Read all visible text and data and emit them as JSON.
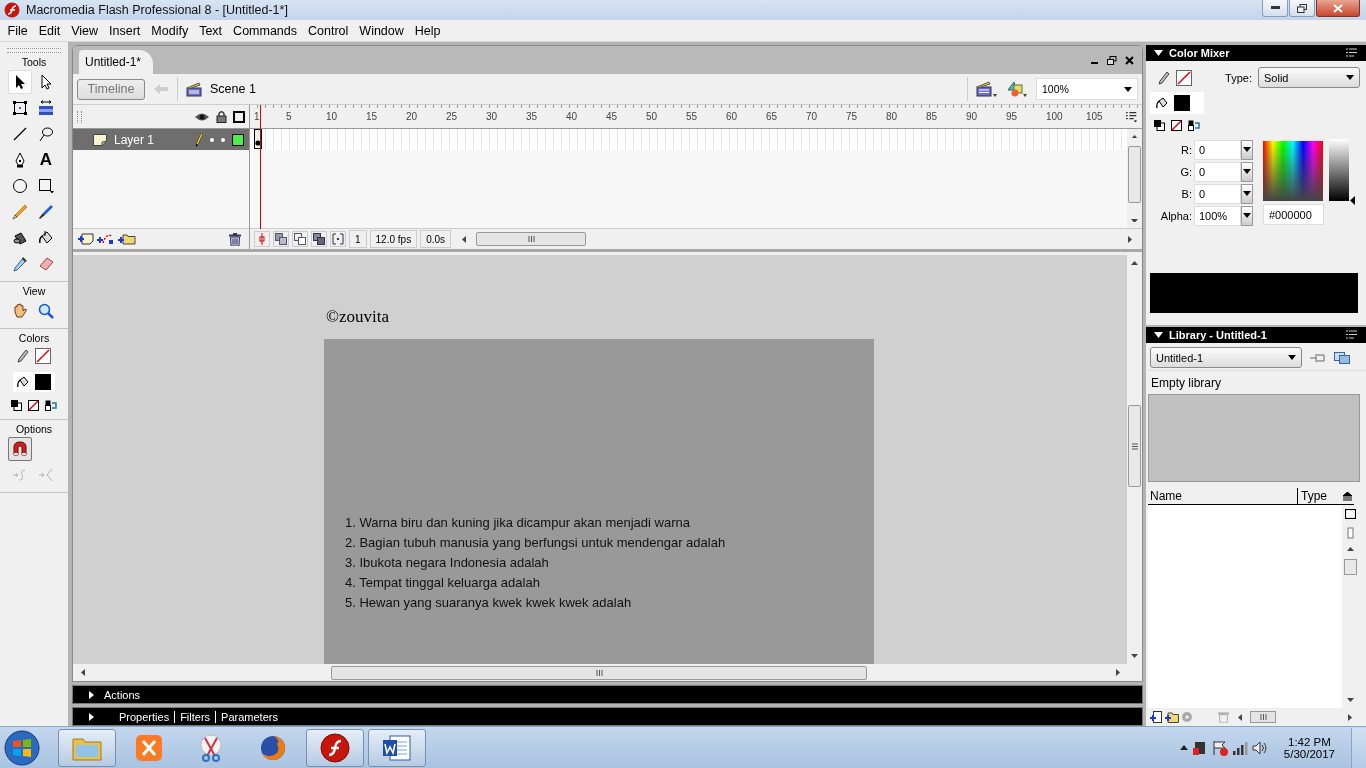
{
  "window": {
    "title": "Macromedia Flash Professional 8 - [Untitled-1*]"
  },
  "menu": [
    "File",
    "Edit",
    "View",
    "Insert",
    "Modify",
    "Text",
    "Commands",
    "Control",
    "Window",
    "Help"
  ],
  "tools_panel": {
    "sections": [
      {
        "label": "Tools",
        "kind": "tools",
        "items": [
          {
            "kind": "pointer",
            "selected": true
          },
          {
            "kind": "hollow-pointer",
            "selected": false
          },
          {
            "kind": "transform-box",
            "selected": false
          },
          {
            "kind": "gradient-transform",
            "selected": false
          },
          {
            "kind": "line",
            "selected": false
          },
          {
            "kind": "lasso",
            "selected": false
          },
          {
            "kind": "pen-nib",
            "selected": false
          },
          {
            "kind": "text",
            "label": "A",
            "selected": false
          },
          {
            "kind": "circle",
            "selected": false
          },
          {
            "kind": "square",
            "selected": false
          },
          {
            "kind": "pencil",
            "selected": false
          },
          {
            "kind": "brush",
            "selected": false
          },
          {
            "kind": "ink-bottle",
            "selected": false
          },
          {
            "kind": "paint-bucket",
            "selected": false
          },
          {
            "kind": "eyedropper",
            "selected": false
          },
          {
            "kind": "eraser",
            "selected": false
          }
        ]
      },
      {
        "label": "View",
        "kind": "tools",
        "items": [
          {
            "kind": "hand",
            "selected": false
          },
          {
            "kind": "magnifier",
            "selected": false
          }
        ]
      },
      {
        "label": "Colors",
        "kind": "colors"
      },
      {
        "label": "Options",
        "kind": "tools",
        "items": [
          {
            "kind": "magnet",
            "selected": true
          },
          {
            "kind": "smooth",
            "selected": false,
            "disabled": true
          },
          {
            "kind": "straighten",
            "selected": false,
            "disabled": true
          }
        ]
      }
    ]
  },
  "document": {
    "tab": "Untitled-1*",
    "timeline_button": "Timeline",
    "scene": "Scene 1",
    "zoom": "100%"
  },
  "timeline": {
    "frame_labels": [
      "1",
      "5",
      "10",
      "15",
      "20",
      "25",
      "30",
      "35",
      "40",
      "45",
      "50",
      "55",
      "60",
      "65",
      "70",
      "75",
      "80",
      "85",
      "90",
      "95",
      "100",
      "105"
    ],
    "layers": [
      {
        "name": "Layer 1",
        "selected": true
      }
    ],
    "current_frame": "1",
    "frame_rate": "12.0 fps",
    "elapsed": "0.0s"
  },
  "stage": {
    "credit": "©zouvita",
    "questions": [
      "1. Warna biru dan kuning jika dicampur akan menjadi warna",
      "2. Bagian tubuh manusia yang berfungsi untuk mendengar adalah",
      "3. Ibukota negara Indonesia adalah",
      "4. Tempat tinggal keluarga adalah",
      "5. Hewan yang suaranya kwek kwek kwek adalah"
    ]
  },
  "panels": {
    "actions": "Actions",
    "properties_tabs": [
      "Properties",
      "Filters",
      "Parameters"
    ]
  },
  "color_mixer": {
    "title": "Color Mixer",
    "type_label": "Type:",
    "type": "Solid",
    "channels": [
      {
        "label": "R:",
        "value": "0"
      },
      {
        "label": "G:",
        "value": "0"
      },
      {
        "label": "B:",
        "value": "0"
      },
      {
        "label": "Alpha:",
        "value": "100%"
      }
    ],
    "brightness": {
      "level": 0
    },
    "hex": "#000000"
  },
  "library": {
    "title": "Library - Untitled-1",
    "document": "Untitled-1",
    "status": "Empty library",
    "columns": [
      "Name",
      "Type"
    ]
  },
  "taskbar": {
    "apps": [
      {
        "kind": "folder",
        "running": true
      },
      {
        "kind": "xampp",
        "running": false
      },
      {
        "kind": "scissors",
        "running": false
      },
      {
        "kind": "firefox",
        "running": false
      },
      {
        "kind": "flash",
        "running": true
      },
      {
        "kind": "word",
        "running": true
      }
    ],
    "time": "1:42 PM",
    "date": "5/30/2017"
  }
}
